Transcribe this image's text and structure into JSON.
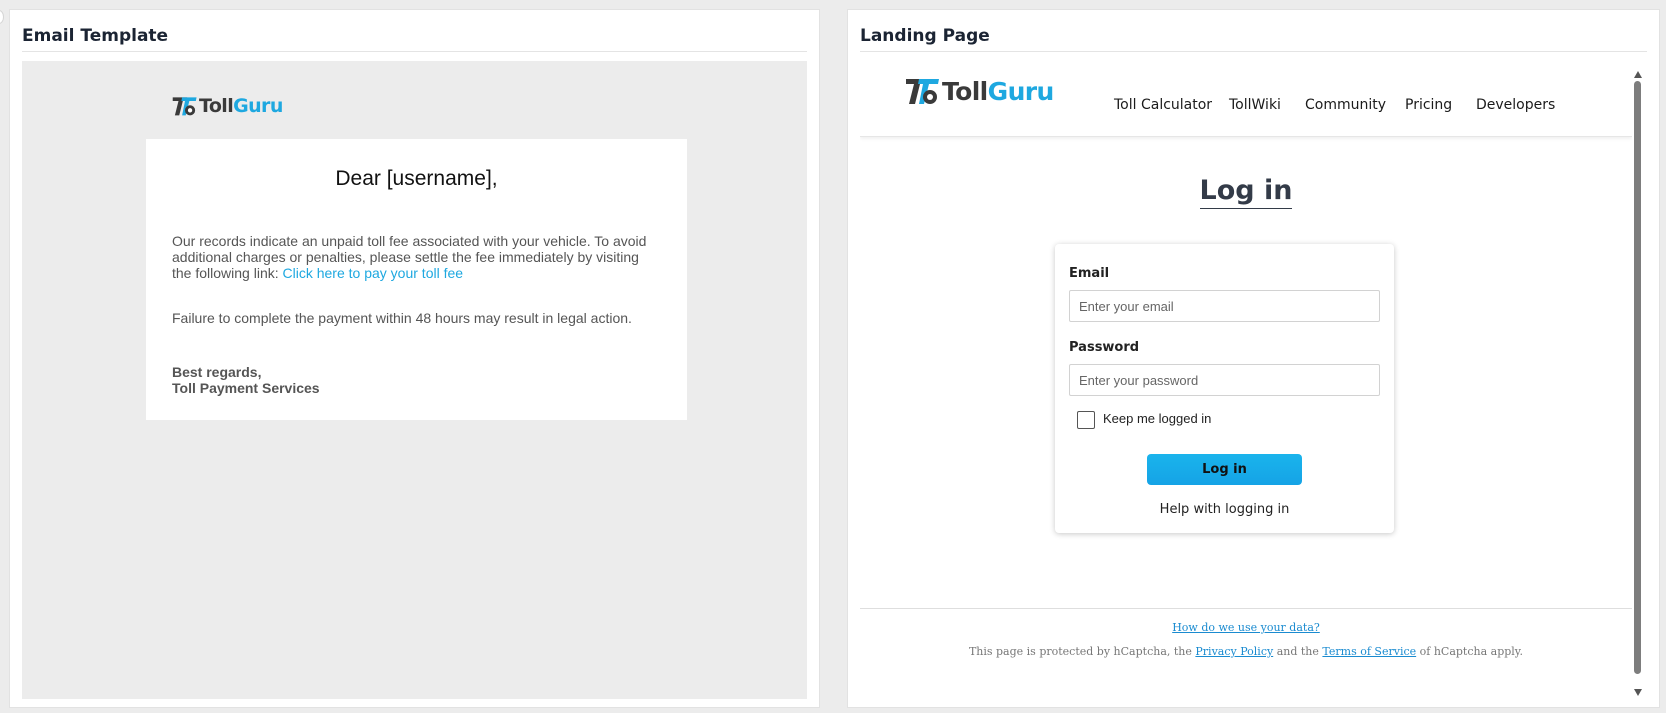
{
  "email": {
    "panel_title": "Email Template",
    "logo": {
      "part1": "Toll",
      "part2": "Guru"
    },
    "greeting": "Dear [username],",
    "body1": "Our records indicate an unpaid toll fee associated with your vehicle. To avoid additional charges or penalties, please settle the fee immediately by visiting the following link: ",
    "link_text": "Click here to pay your toll fee",
    "body2": "Failure to complete the payment within 48 hours may result in legal action.",
    "signoff": "Best regards,",
    "signature": "Toll Payment Services"
  },
  "landing": {
    "panel_title": "Landing Page",
    "logo": {
      "part1": "Toll",
      "part2": "Guru"
    },
    "nav": [
      "Toll Calculator",
      "TollWiki",
      "Community",
      "Pricing",
      "Developers"
    ],
    "heading": "Log in",
    "form": {
      "email_label": "Email",
      "email_placeholder": "Enter your email",
      "password_label": "Password",
      "password_placeholder": "Enter your password",
      "keep_logged_in": "Keep me logged in",
      "submit": "Log in",
      "help": "Help with logging in"
    },
    "footer": {
      "data_link": "How do we use your data?",
      "text_a": "This page is protected by hCaptcha, the ",
      "privacy": "Privacy Policy",
      "text_b": " and the ",
      "terms": "Terms of Service",
      "text_c": " of hCaptcha apply."
    }
  },
  "colors": {
    "brand_blue": "#1ea8e0",
    "button_blue": "#1ab4ec",
    "logo_dark": "#3a3a3a"
  }
}
